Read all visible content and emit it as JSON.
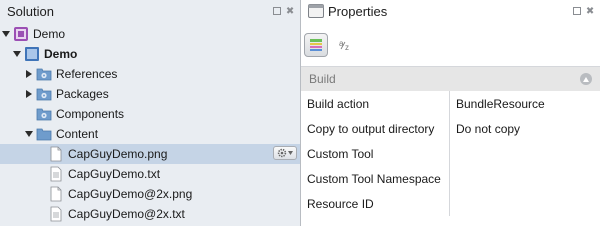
{
  "solution_pad": {
    "title": "Solution",
    "tree": [
      {
        "label": "Demo",
        "bold": false,
        "icon": "solution-icon",
        "expanded": true
      },
      {
        "label": "Demo",
        "bold": true,
        "icon": "project-icon",
        "expanded": true
      },
      {
        "label": "References",
        "icon": "folder-gear-icon",
        "expanded": false
      },
      {
        "label": "Packages",
        "icon": "folder-gear-icon",
        "expanded": false
      },
      {
        "label": "Components",
        "icon": "folder-gear-icon"
      },
      {
        "label": "Content",
        "icon": "folder-icon",
        "expanded": true
      },
      {
        "label": "CapGuyDemo.png",
        "icon": "file-icon",
        "selected": true
      },
      {
        "label": "CapGuyDemo.txt",
        "icon": "file-icon"
      },
      {
        "label": "CapGuyDemo@2x.png",
        "icon": "file-icon"
      },
      {
        "label": "CapGuyDemo@2x.txt",
        "icon": "file-icon"
      }
    ]
  },
  "properties_pad": {
    "title": "Properties",
    "category": "Build",
    "rows": [
      {
        "name": "Build action",
        "value": "BundleResource"
      },
      {
        "name": "Copy to output directory",
        "value": "Do not copy"
      },
      {
        "name": "Custom Tool",
        "value": ""
      },
      {
        "name": "Custom Tool Namespace",
        "value": ""
      },
      {
        "name": "Resource ID",
        "value": ""
      }
    ]
  },
  "colors": {
    "selection": "#c5d4e6",
    "pad_background": "#e9edf2",
    "folder_blue": "#5b86bd"
  }
}
